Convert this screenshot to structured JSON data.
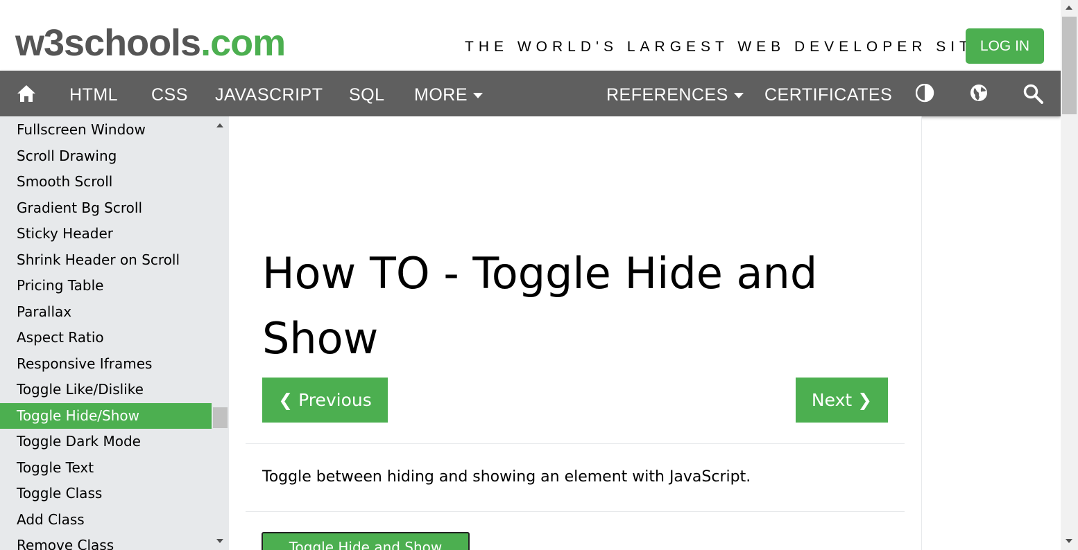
{
  "header": {
    "logo_main": "w3schools",
    "logo_suffix": ".com",
    "tagline": "THE WORLD'S LARGEST WEB DEVELOPER SITE",
    "login_label": "LOG IN",
    "accent_color": "#4caf50"
  },
  "nav": {
    "home_icon": "home-icon",
    "items": [
      "HTML",
      "CSS",
      "JAVASCRIPT",
      "SQL",
      "MORE",
      "REFERENCES",
      "CERTIFICATES"
    ],
    "icons": [
      "contrast-icon",
      "globe-icon",
      "search-icon"
    ]
  },
  "sidebar": {
    "items": [
      "Fullscreen Window",
      "Scroll Drawing",
      "Smooth Scroll",
      "Gradient Bg Scroll",
      "Sticky Header",
      "Shrink Header on Scroll",
      "Pricing Table",
      "Parallax",
      "Aspect Ratio",
      "Responsive Iframes",
      "Toggle Like/Dislike",
      "Toggle Hide/Show",
      "Toggle Dark Mode",
      "Toggle Text",
      "Toggle Class",
      "Add Class",
      "Remove Class"
    ],
    "active_item": "Toggle Hide/Show"
  },
  "main": {
    "title": "How TO - Toggle Hide and Show",
    "prev_label": "❮ Previous",
    "next_label": "Next ❯",
    "intro": "Toggle between hiding and showing an element with JavaScript.",
    "toggle_button_label": "Toggle Hide and Show"
  }
}
